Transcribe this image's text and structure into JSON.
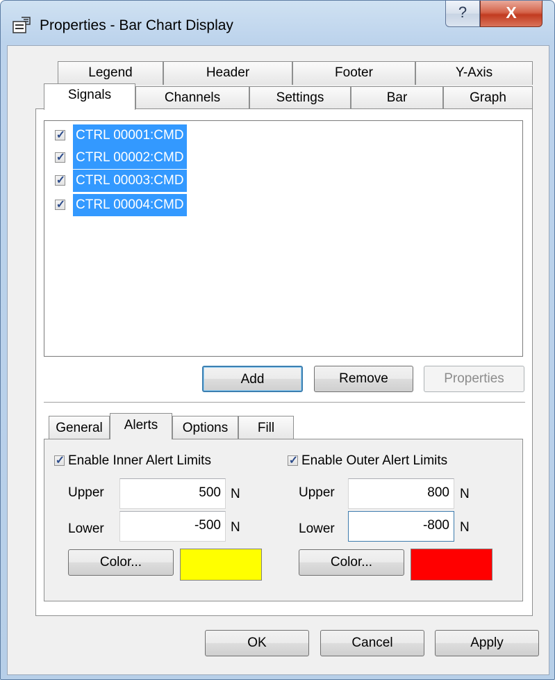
{
  "window": {
    "title": "Properties - Bar Chart Display",
    "help_glyph": "?",
    "close_glyph": "X"
  },
  "tabs_row_back": [
    "Legend",
    "Header",
    "Footer",
    "Y-Axis"
  ],
  "tabs_row_front": [
    "Signals",
    "Channels",
    "Settings",
    "Bar",
    "Graph"
  ],
  "active_tab": "Signals",
  "signals": [
    {
      "label": "CTRL 00001:CMD",
      "checked": true
    },
    {
      "label": "CTRL 00002:CMD",
      "checked": true
    },
    {
      "label": "CTRL 00003:CMD",
      "checked": true
    },
    {
      "label": "CTRL 00004:CMD",
      "checked": true
    }
  ],
  "list_buttons": {
    "add": "Add",
    "remove": "Remove",
    "properties": "Properties"
  },
  "sub_tabs": [
    "General",
    "Alerts",
    "Options",
    "Fill"
  ],
  "active_sub_tab": "Alerts",
  "inner_alert": {
    "enable_label": "Enable Inner Alert Limits",
    "checked": true,
    "upper_label": "Upper",
    "upper_value": "500",
    "lower_label": "Lower",
    "lower_value": "-500",
    "unit": "N",
    "color_button": "Color...",
    "color": "#ffff00"
  },
  "outer_alert": {
    "enable_label": "Enable Outer Alert Limits",
    "checked": true,
    "upper_label": "Upper",
    "upper_value": "800",
    "lower_label": "Lower",
    "lower_value": "-800",
    "unit": "N",
    "color_button": "Color...",
    "color": "#ff0000"
  },
  "dialog_buttons": {
    "ok": "OK",
    "cancel": "Cancel",
    "apply": "Apply"
  },
  "checkmark": "✓"
}
